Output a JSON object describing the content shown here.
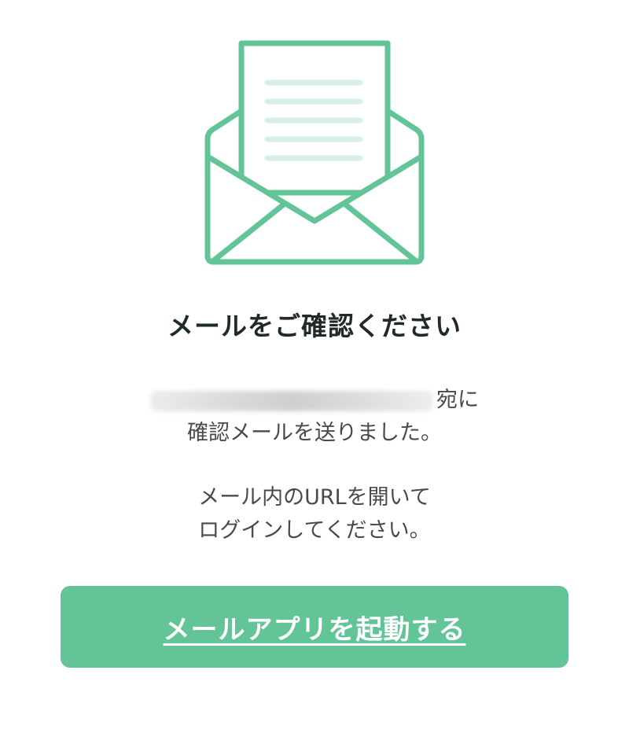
{
  "icon": {
    "name": "open-envelope-icon",
    "stroke_color": "#63c597",
    "line_color": "#d8f0e4"
  },
  "title": "メールをご確認ください",
  "message": {
    "email_suffix": "宛に",
    "sent_line": "確認メールを送りました。",
    "open_line": "メール内のURLを開いて",
    "login_line": "ログインしてください。"
  },
  "button": {
    "label": "メールアプリを起動する",
    "color": "#63c597"
  }
}
